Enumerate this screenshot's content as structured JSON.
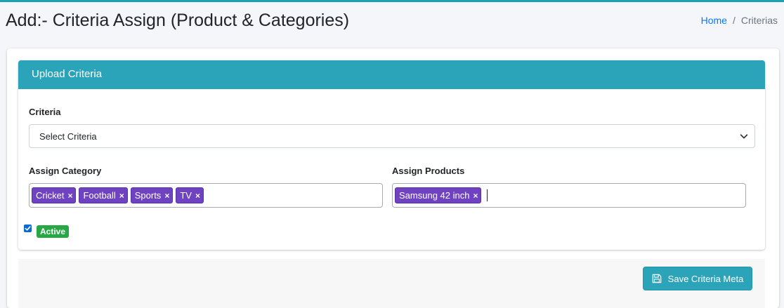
{
  "page": {
    "title": "Add:- Criteria Assign (Product & Categories)"
  },
  "breadcrumb": {
    "home": "Home",
    "separator": "/",
    "current": "Criterias"
  },
  "card": {
    "header": "Upload Criteria"
  },
  "criteria": {
    "label": "Criteria",
    "selected": "Select Criteria"
  },
  "assign_category": {
    "label": "Assign Category",
    "tags": [
      "Cricket",
      "Football",
      "Sports",
      "TV"
    ]
  },
  "assign_products": {
    "label": "Assign Products",
    "tags": [
      "Samsung 42 inch"
    ]
  },
  "active": {
    "checked": true,
    "badge": "Active"
  },
  "save_button": {
    "label": "Save Criteria Meta",
    "icon": "save-icon"
  },
  "tag_remove_symbol": "×",
  "colors": {
    "accent": "#2ba3b8",
    "tag": "#6f42c1",
    "badge": "#28a745",
    "link": "#007bff",
    "checkbox": "#0b6bd3"
  }
}
